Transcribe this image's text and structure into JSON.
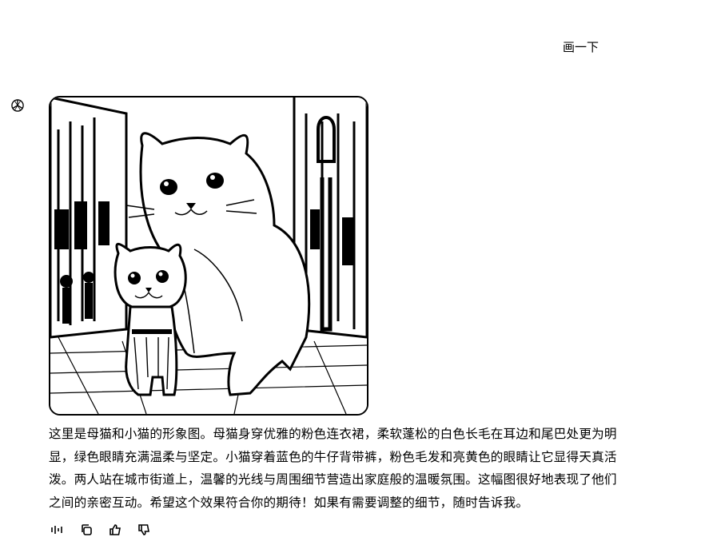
{
  "conversation": {
    "user_message": "画一下",
    "assistant_reply": "这里是母猫和小猫的形象图。母猫身穿优雅的粉色连衣裙，柔软蓬松的白色长毛在耳边和尾巴处更为明显，绿色眼睛充满温柔与坚定。小猫穿着蓝色的牛仔背带裤，粉色毛发和亮黄色的眼睛让它显得天真活泼。两人站在城市街道上，温馨的光线与周围细节营造出家庭般的温暖氛围。这幅图很好地表现了他们之间的亲密互动。希望这个效果符合你的期待！如果有需要调整的细节，随时告诉我。"
  },
  "icons": {
    "assistant_avatar": "openai-logo-icon",
    "actions": [
      "read-aloud-icon",
      "copy-icon",
      "thumbs-up-icon",
      "thumbs-down-icon"
    ]
  }
}
